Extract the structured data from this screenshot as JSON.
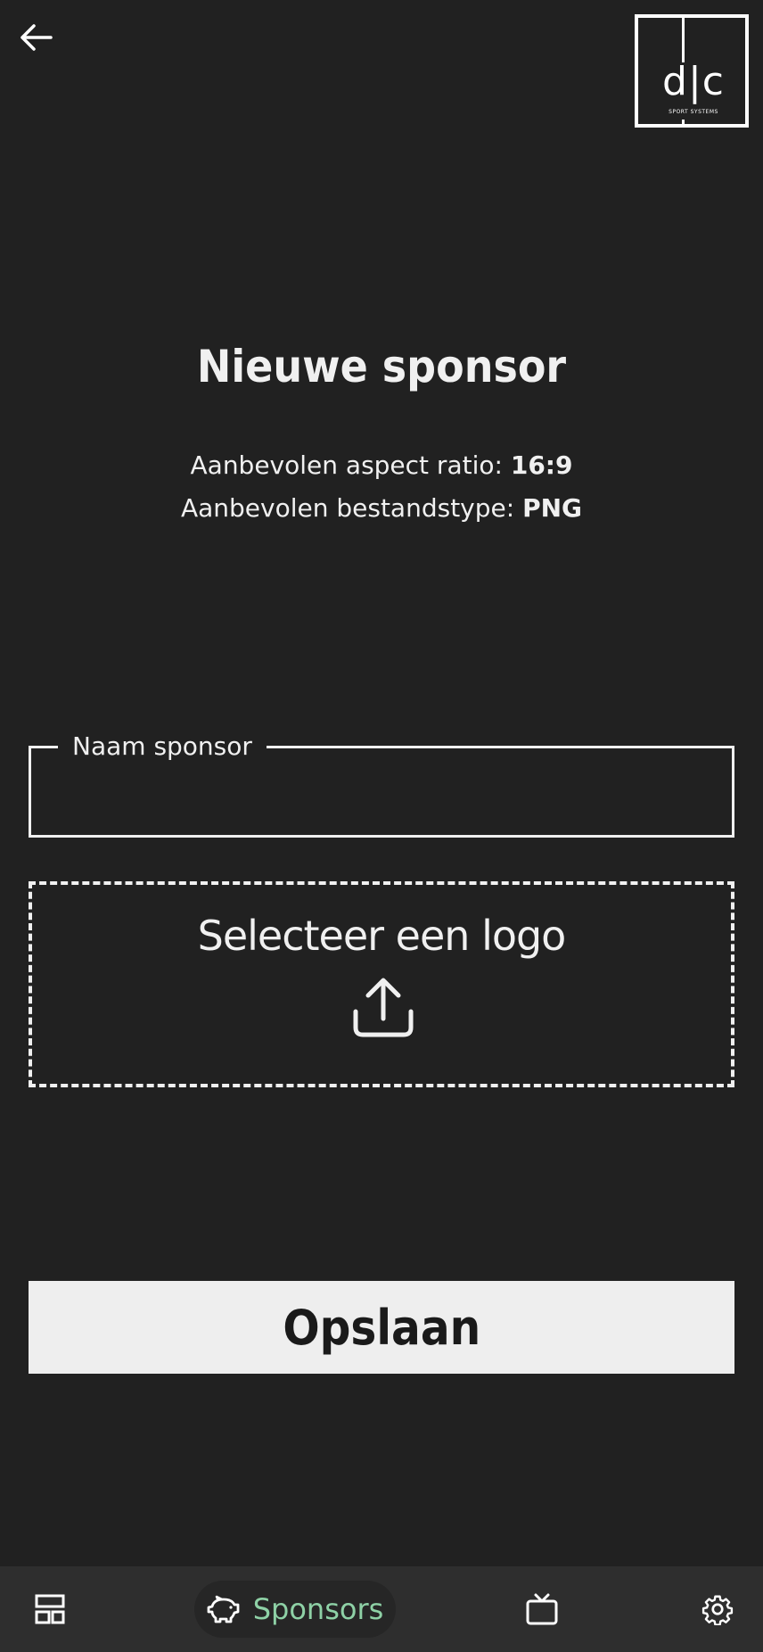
{
  "header": {
    "back_icon": "arrow-left-icon",
    "logo": {
      "letters": "d|c",
      "tagline": "SPORT SYSTEMS"
    }
  },
  "main": {
    "title": "Nieuwe sponsor",
    "aspect_label": "Aanbevolen aspect ratio:",
    "aspect_value": "16:9",
    "filetype_label": "Aanbevolen bestandstype:",
    "filetype_value": "PNG",
    "name_field": {
      "label": "Naam sponsor",
      "value": ""
    },
    "upload": {
      "label": "Selecteer een logo",
      "icon": "upload-icon"
    },
    "save_label": "Opslaan"
  },
  "nav": {
    "items": [
      {
        "icon": "dashboard-icon",
        "label": ""
      },
      {
        "icon": "piggy-bank-icon",
        "label": "Sponsors",
        "active": true
      },
      {
        "icon": "tv-icon",
        "label": ""
      },
      {
        "icon": "gear-icon",
        "label": ""
      }
    ],
    "active_color": "#8ed1a6"
  },
  "colors": {
    "background": "#212121",
    "text": "#f0f0f0",
    "button_bg": "#eeeeee",
    "nav_bg": "#2e2e2e"
  }
}
